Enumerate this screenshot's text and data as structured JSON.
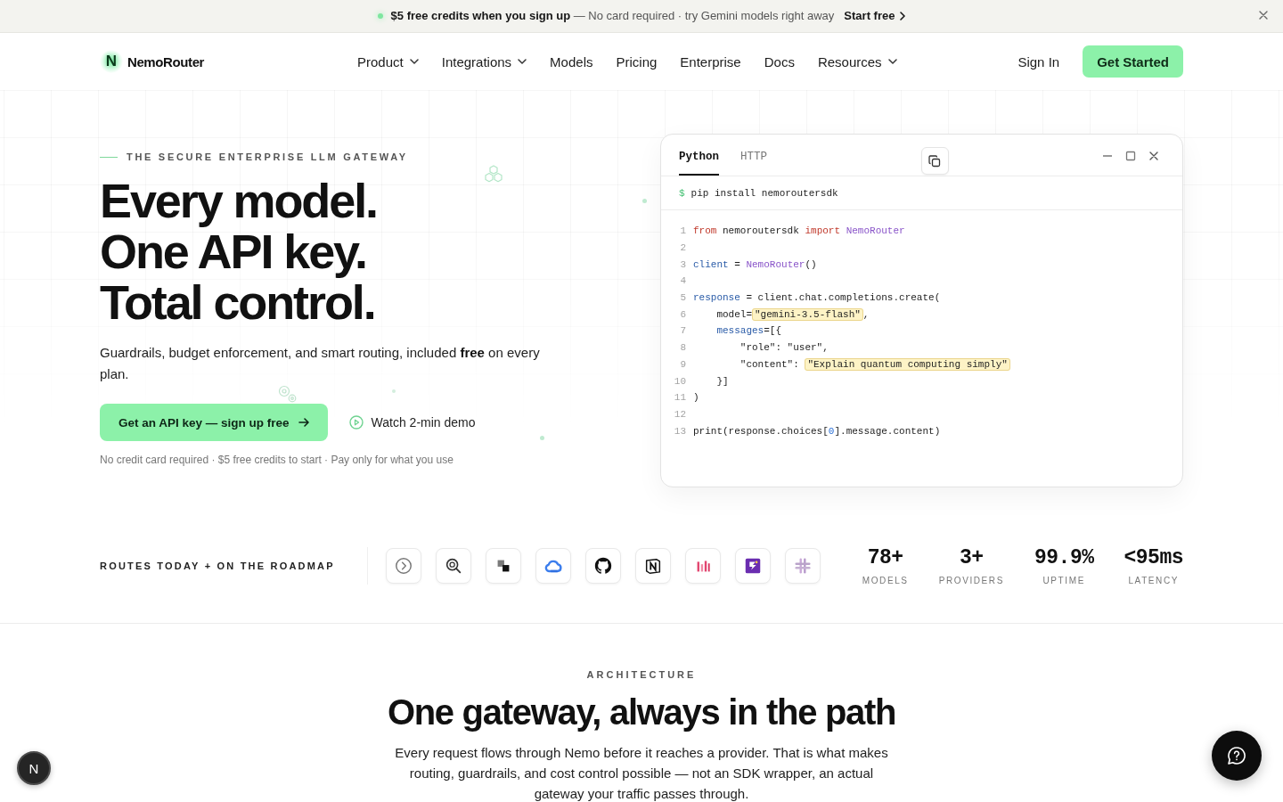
{
  "banner": {
    "message": "**$5 free credits when you sign up** — No card required · try Gemini models right away",
    "link": "Start free"
  },
  "nav": {
    "brand": {
      "mark": "N",
      "name": "NemoRouter"
    },
    "items": [
      {
        "label": "Product",
        "has_menu": true
      },
      {
        "label": "Integrations",
        "has_menu": true
      },
      {
        "label": "Models",
        "has_menu": false
      },
      {
        "label": "Pricing",
        "has_menu": false
      },
      {
        "label": "Enterprise",
        "has_menu": false
      },
      {
        "label": "Docs",
        "has_menu": false
      },
      {
        "label": "Resources",
        "has_menu": true
      }
    ],
    "sign_in": "Sign In",
    "cta": "Get Started"
  },
  "hero": {
    "eyebrow": "THE SECURE ENTERPRISE LLM GATEWAY",
    "headline": [
      "Every model.",
      "One API key.",
      "Total control."
    ],
    "subtitle": "Guardrails, budget enforcement, and smart routing, included **free** on every plan.",
    "primary_button": "Get an API key — sign up free",
    "secondary_button": "Watch 2-min demo",
    "note": "No credit card required · $5 free credits to start · Pay only for what you use"
  },
  "code_panel": {
    "tabs": [
      {
        "label": "Python",
        "selected": true
      },
      {
        "label": "HTTP",
        "selected": false
      }
    ],
    "prompt": "$",
    "command": "pip install nemoroutersdk",
    "lines": [
      {
        "number": "1",
        "tokens": [
          {
            "kind": "keyword",
            "text": "from"
          },
          {
            "kind": "plain",
            "text": " nemoroutersdk "
          },
          {
            "kind": "keyword",
            "text": "import"
          },
          {
            "kind": "class",
            "text": " NemoRouter"
          }
        ]
      },
      {
        "number": "2"
      },
      {
        "number": "3",
        "tokens": [
          {
            "kind": "variable",
            "text": "client"
          },
          {
            "kind": "plain",
            "text": " = "
          },
          {
            "kind": "class",
            "text": "NemoRouter"
          },
          {
            "kind": "plain",
            "text": "()"
          }
        ]
      },
      {
        "number": "4"
      },
      {
        "number": "5",
        "tokens": [
          {
            "kind": "variable",
            "text": "response"
          },
          {
            "kind": "plain",
            "text": " = client.chat.completions.create("
          }
        ]
      },
      {
        "number": "6",
        "tokens": [
          {
            "kind": "plain",
            "text": "    model="
          },
          {
            "kind": "highlight",
            "text": "\"gemini-3.5-flash\""
          },
          {
            "kind": "plain",
            "text": ","
          }
        ]
      },
      {
        "number": "7",
        "tokens": [
          {
            "kind": "variable",
            "text": "    messages"
          },
          {
            "kind": "plain",
            "text": "=[{"
          }
        ]
      },
      {
        "number": "8",
        "tokens": [
          {
            "kind": "plain",
            "text": "        \"role\": \"user\","
          }
        ]
      },
      {
        "number": "9",
        "tokens": [
          {
            "kind": "plain",
            "text": "        \"content\": "
          },
          {
            "kind": "highlight",
            "text": "\"Explain quantum computing simply\""
          }
        ]
      },
      {
        "number": "10",
        "tokens": [
          {
            "kind": "plain",
            "text": "    }]"
          }
        ]
      },
      {
        "number": "11",
        "tokens": [
          {
            "kind": "plain",
            "text": ")"
          }
        ]
      },
      {
        "number": "12"
      },
      {
        "number": "13",
        "tokens": [
          {
            "kind": "plain",
            "text": "print(response.choices["
          },
          {
            "kind": "number",
            "text": "0"
          },
          {
            "kind": "plain",
            "text": "].message.content)"
          }
        ]
      }
    ]
  },
  "proof_bar": {
    "label": "ROUTES TODAY + ON THE ROADMAP",
    "stats": [
      {
        "value": "78+",
        "label": "MODELS"
      },
      {
        "value": "3+",
        "label": "PROVIDERS"
      },
      {
        "value": "99.9%",
        "label": "UPTIME"
      },
      {
        "value": "<95ms",
        "label": "LATENCY"
      }
    ]
  },
  "architecture": {
    "eyebrow": "ARCHITECTURE",
    "title": "One gateway, always in the path",
    "body": "Every request flows through Nemo before it reaches a provider. That is what makes routing, guardrails, and cost control possible — not an SDK wrapper, an actual gateway your traffic passes through."
  },
  "floating_badge": {
    "letter": "N"
  }
}
